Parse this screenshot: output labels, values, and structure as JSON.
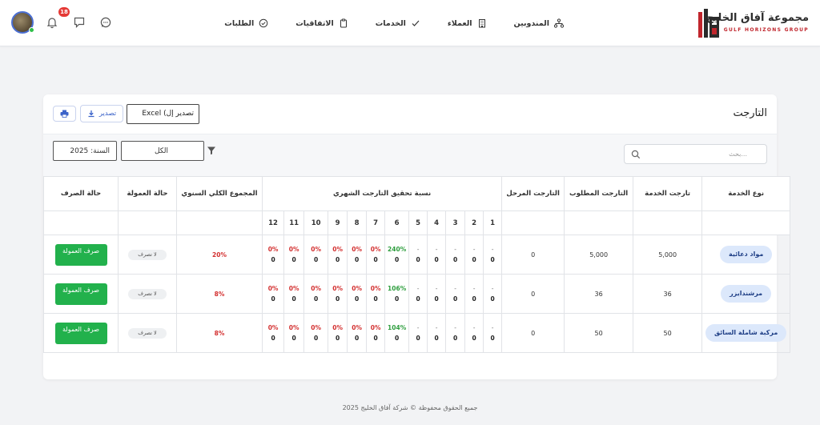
{
  "brand": {
    "title": "مجموعة آفاق الخليج",
    "subtitle": "GULF HORIZONS GROUP"
  },
  "nav": {
    "items": [
      {
        "label": "المندوبين",
        "icon": "network-icon"
      },
      {
        "label": "العملاء",
        "icon": "building-icon"
      },
      {
        "label": "الخدمات",
        "icon": "check-icon"
      },
      {
        "label": "الاتفاقيات",
        "icon": "clipboard-icon"
      },
      {
        "label": "الطلبات",
        "icon": "circle-check-icon"
      }
    ]
  },
  "header_icons": {
    "notification_count": "18"
  },
  "card": {
    "title": "التارجت",
    "excel_label": "Excel (تصدير إل",
    "export_label": "تصدير"
  },
  "filters": {
    "search_placeholder": "بحث...",
    "category_value": "الكل",
    "year_value": "السنة: 2025"
  },
  "table": {
    "headers": {
      "service_type": "نوع الخدمة",
      "service_target": "تارجت الخدمة",
      "required_target": "التارجت المطلوب",
      "carried_target": "التارجت المرحل",
      "monthly_ratio": "نسبة تحقيق التارجت الشهري",
      "annual_total": "المجموع الكلي السنوي",
      "commission_status": "حالة العمولة",
      "payment_status": "حالة الصرف"
    },
    "months": [
      "1",
      "2",
      "3",
      "4",
      "5",
      "6",
      "7",
      "8",
      "9",
      "10",
      "11",
      "12"
    ],
    "rows": [
      {
        "service": "مواد دعائية",
        "service_target": "5,000",
        "required_target": "5,000",
        "carried": "0",
        "monthly": [
          {
            "p": "-",
            "v": "0",
            "c": "dash"
          },
          {
            "p": "-",
            "v": "0",
            "c": "dash"
          },
          {
            "p": "-",
            "v": "0",
            "c": "dash"
          },
          {
            "p": "-",
            "v": "0",
            "c": "dash"
          },
          {
            "p": "-",
            "v": "0",
            "c": "dash"
          },
          {
            "p": "240%",
            "v": "0",
            "c": "green"
          },
          {
            "p": "0%",
            "v": "0",
            "c": "red"
          },
          {
            "p": "0%",
            "v": "0",
            "c": "red"
          },
          {
            "p": "0%",
            "v": "0",
            "c": "red"
          },
          {
            "p": "0%",
            "v": "0",
            "c": "red"
          },
          {
            "p": "0%",
            "v": "0",
            "c": "red"
          },
          {
            "p": "0%",
            "v": "0",
            "c": "red"
          }
        ],
        "annual": "20%",
        "commission": "لا تصرف",
        "payment": "صرف العمولة"
      },
      {
        "service": "مرشندايزر",
        "service_target": "36",
        "required_target": "36",
        "carried": "0",
        "monthly": [
          {
            "p": "-",
            "v": "0",
            "c": "dash"
          },
          {
            "p": "-",
            "v": "0",
            "c": "dash"
          },
          {
            "p": "-",
            "v": "0",
            "c": "dash"
          },
          {
            "p": "-",
            "v": "0",
            "c": "dash"
          },
          {
            "p": "-",
            "v": "0",
            "c": "dash"
          },
          {
            "p": "106%",
            "v": "0",
            "c": "green"
          },
          {
            "p": "0%",
            "v": "0",
            "c": "red"
          },
          {
            "p": "0%",
            "v": "0",
            "c": "red"
          },
          {
            "p": "0%",
            "v": "0",
            "c": "red"
          },
          {
            "p": "0%",
            "v": "0",
            "c": "red"
          },
          {
            "p": "0%",
            "v": "0",
            "c": "red"
          },
          {
            "p": "0%",
            "v": "0",
            "c": "red"
          }
        ],
        "annual": "8%",
        "commission": "لا تصرف",
        "payment": "صرف العمولة"
      },
      {
        "service": "مركبة شاملة السائق",
        "service_target": "50",
        "required_target": "50",
        "carried": "0",
        "monthly": [
          {
            "p": "-",
            "v": "0",
            "c": "dash"
          },
          {
            "p": "-",
            "v": "0",
            "c": "dash"
          },
          {
            "p": "-",
            "v": "0",
            "c": "dash"
          },
          {
            "p": "-",
            "v": "0",
            "c": "dash"
          },
          {
            "p": "-",
            "v": "0",
            "c": "dash"
          },
          {
            "p": "104%",
            "v": "0",
            "c": "green"
          },
          {
            "p": "0%",
            "v": "0",
            "c": "red"
          },
          {
            "p": "0%",
            "v": "0",
            "c": "red"
          },
          {
            "p": "0%",
            "v": "0",
            "c": "red"
          },
          {
            "p": "0%",
            "v": "0",
            "c": "red"
          },
          {
            "p": "0%",
            "v": "0",
            "c": "red"
          },
          {
            "p": "0%",
            "v": "0",
            "c": "red"
          }
        ],
        "annual": "8%",
        "commission": "لا تصرف",
        "payment": "صرف العمولة"
      }
    ]
  },
  "footer": {
    "text": "جميع الحقوق محفوظة © شركة آفاق الخليج 2025"
  },
  "colors": {
    "accent": "#3b63c9",
    "success": "#22b14c",
    "danger": "#d32f2f",
    "brand_red": "#c0262d"
  }
}
